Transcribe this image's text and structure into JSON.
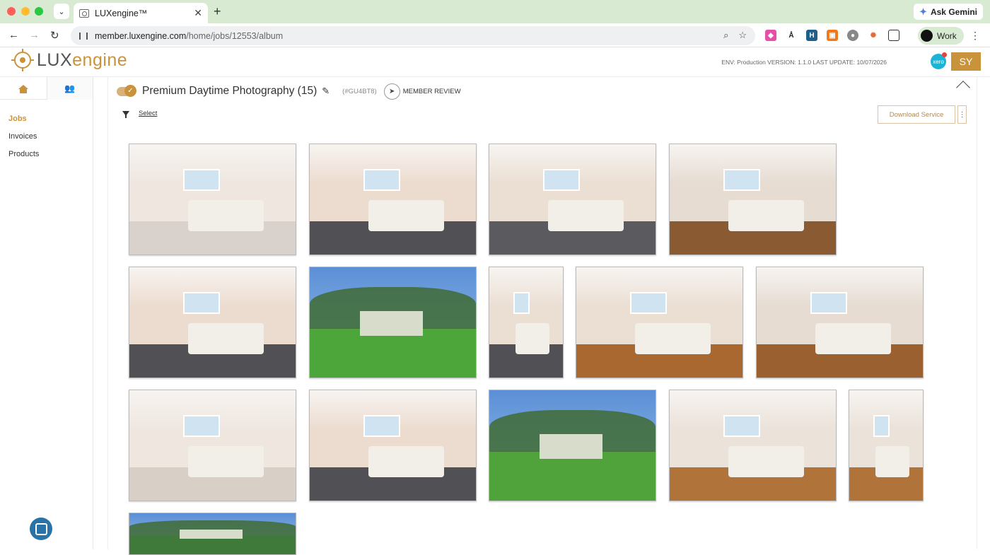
{
  "browser": {
    "tab_title": "LUXengine™",
    "url_host": "member.luxengine.com",
    "url_path": "/home/jobs/12553/album",
    "ask_gemini": "Ask Gemini",
    "profile_label": "Work"
  },
  "header": {
    "logo_lux": "LUX",
    "logo_engine": "engine",
    "env_info": "ENV: Production VERSION: 1.1.0 LAST UPDATE: 10/07/2026",
    "xero_label": "xero",
    "user_initials": "SY"
  },
  "sidebar": {
    "items": [
      {
        "label": "Jobs",
        "active": true
      },
      {
        "label": "Invoices",
        "active": false
      },
      {
        "label": "Products",
        "active": false
      }
    ]
  },
  "job": {
    "title": "Premium Daytime Photography (15)",
    "code": "(#GU4BT8)",
    "member_review": "MEMBER REVIEW",
    "select_label": "Select",
    "download_label": "Download Service"
  },
  "photos": [
    {
      "subject": "bathroom",
      "wall": "#efe6e0",
      "floor": "#d9d2cc"
    },
    {
      "subject": "bedroom",
      "wall": "#ecdcd0",
      "floor": "#505055"
    },
    {
      "subject": "living room",
      "wall": "#ebdfd4",
      "floor": "#5a5a5f"
    },
    {
      "subject": "open living",
      "wall": "#e6dcd2",
      "floor": "#8a5a32"
    },
    {
      "subject": "bedroom",
      "wall": "#ecdcd0",
      "floor": "#505055"
    },
    {
      "subject": "backyard deck",
      "wall": "#6a9ad8",
      "floor": "#4da63a"
    },
    {
      "subject": "study nook",
      "wall": "#ebdfd4",
      "floor": "#505055"
    },
    {
      "subject": "hallway",
      "wall": "#ebdfd4",
      "floor": "#a8682f"
    },
    {
      "subject": "dining",
      "wall": "#e6dcd2",
      "floor": "#9a6030"
    },
    {
      "subject": "ensuite",
      "wall": "#efe6e0",
      "floor": "#d8cfc6"
    },
    {
      "subject": "bedroom",
      "wall": "#ecdcd0",
      "floor": "#505055"
    },
    {
      "subject": "rear exterior",
      "wall": "#5f93d6",
      "floor": "#4fa33a"
    },
    {
      "subject": "kitchen",
      "wall": "#ebe2da",
      "floor": "#b0743a"
    },
    {
      "subject": "kitchen detail",
      "wall": "#ebe2da",
      "floor": "#b0743a"
    },
    {
      "subject": "trees and sky",
      "wall": "#6a9ad8",
      "floor": "#3f7a3a"
    }
  ]
}
